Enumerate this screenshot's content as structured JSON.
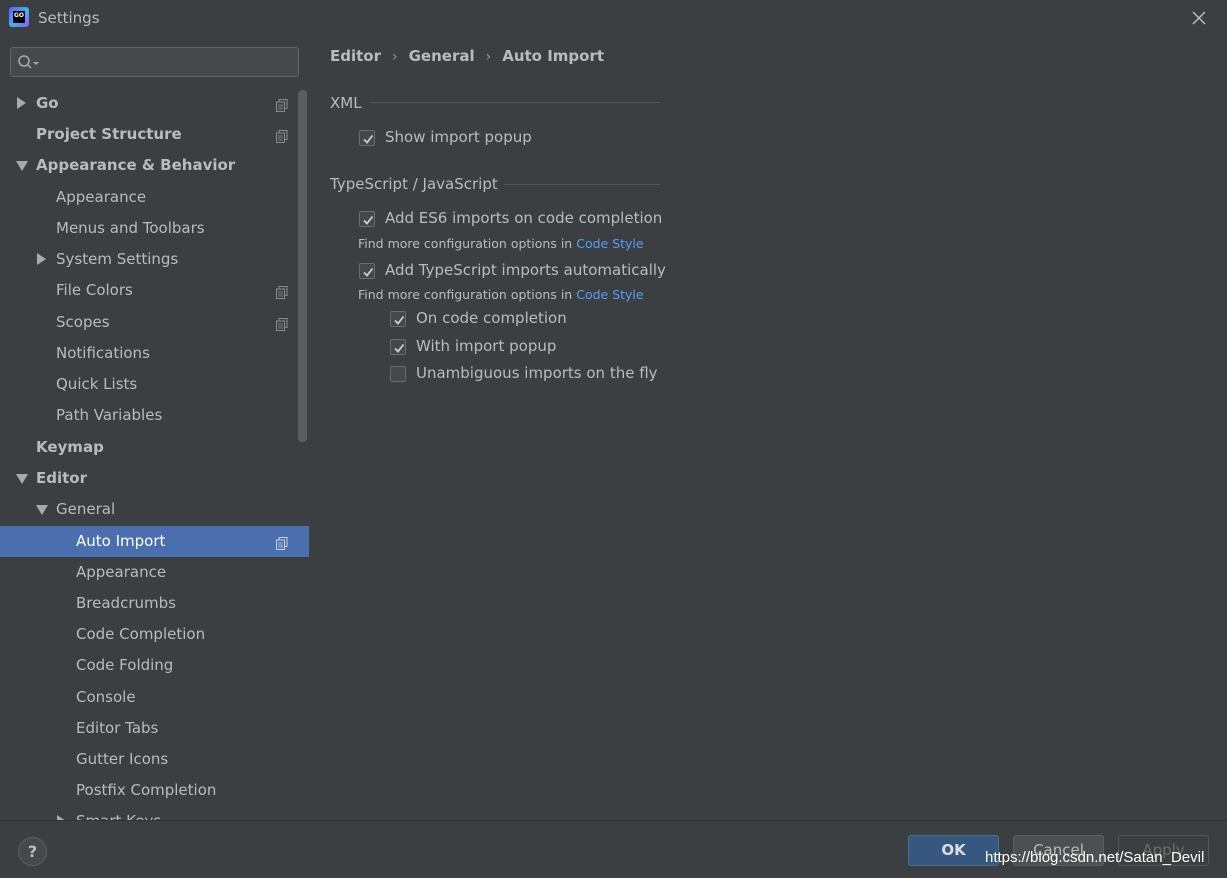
{
  "window": {
    "title": "Settings"
  },
  "search": {
    "placeholder": "",
    "value": ""
  },
  "sidebar": {
    "items": [
      {
        "label": "Go",
        "expander": "collapsed",
        "copy": true,
        "bold": true
      },
      {
        "label": "Project Structure",
        "expander": "none",
        "copy": true,
        "bold": true
      },
      {
        "label": "Appearance & Behavior",
        "expander": "expanded",
        "copy": false,
        "bold": true
      },
      {
        "label": "Appearance",
        "expander": "none",
        "copy": false,
        "bold": false
      },
      {
        "label": "Menus and Toolbars",
        "expander": "none",
        "copy": false,
        "bold": false
      },
      {
        "label": "System Settings",
        "expander": "collapsed",
        "copy": false,
        "bold": false
      },
      {
        "label": "File Colors",
        "expander": "none",
        "copy": true,
        "bold": false
      },
      {
        "label": "Scopes",
        "expander": "none",
        "copy": true,
        "bold": false
      },
      {
        "label": "Notifications",
        "expander": "none",
        "copy": false,
        "bold": false
      },
      {
        "label": "Quick Lists",
        "expander": "none",
        "copy": false,
        "bold": false
      },
      {
        "label": "Path Variables",
        "expander": "none",
        "copy": false,
        "bold": false
      },
      {
        "label": "Keymap",
        "expander": "none",
        "copy": false,
        "bold": true
      },
      {
        "label": "Editor",
        "expander": "expanded",
        "copy": false,
        "bold": true
      },
      {
        "label": "General",
        "expander": "expanded",
        "copy": false,
        "bold": false
      },
      {
        "label": "Auto Import",
        "expander": "none",
        "copy": true,
        "bold": false,
        "selected": true
      },
      {
        "label": "Appearance",
        "expander": "none",
        "copy": false,
        "bold": false
      },
      {
        "label": "Breadcrumbs",
        "expander": "none",
        "copy": false,
        "bold": false
      },
      {
        "label": "Code Completion",
        "expander": "none",
        "copy": false,
        "bold": false
      },
      {
        "label": "Code Folding",
        "expander": "none",
        "copy": false,
        "bold": false
      },
      {
        "label": "Console",
        "expander": "none",
        "copy": false,
        "bold": false
      },
      {
        "label": "Editor Tabs",
        "expander": "none",
        "copy": false,
        "bold": false
      },
      {
        "label": "Gutter Icons",
        "expander": "none",
        "copy": false,
        "bold": false
      },
      {
        "label": "Postfix Completion",
        "expander": "none",
        "copy": false,
        "bold": false
      },
      {
        "label": "Smart Keys",
        "expander": "collapsed",
        "copy": false,
        "bold": false
      }
    ]
  },
  "breadcrumb": [
    "Editor",
    "General",
    "Auto Import"
  ],
  "sections": {
    "xml": {
      "title": "XML",
      "show_import_popup": {
        "label": "Show import popup",
        "checked": true
      }
    },
    "ts": {
      "title": "TypeScript / JavaScript",
      "es6": {
        "label": "Add ES6 imports on code completion",
        "checked": true
      },
      "hint1": {
        "text": "Find more configuration options in ",
        "link": "Code Style"
      },
      "ts_auto": {
        "label": "Add TypeScript imports automatically",
        "checked": true
      },
      "hint2": {
        "text": "Find more configuration options in ",
        "link": "Code Style"
      },
      "on_completion": {
        "label": "On code completion",
        "checked": true
      },
      "with_popup": {
        "label": "With import popup",
        "checked": true
      },
      "unambiguous": {
        "label": "Unambiguous imports on the fly",
        "checked": false
      }
    }
  },
  "footer": {
    "help": "?",
    "ok": "OK",
    "cancel": "Cancel",
    "apply": "Apply",
    "watermark": "https://blog.csdn.net/Satan_Devil"
  },
  "colors": {
    "accent": "#4b6eaf",
    "link": "#589df6",
    "background": "#3c3f41"
  }
}
